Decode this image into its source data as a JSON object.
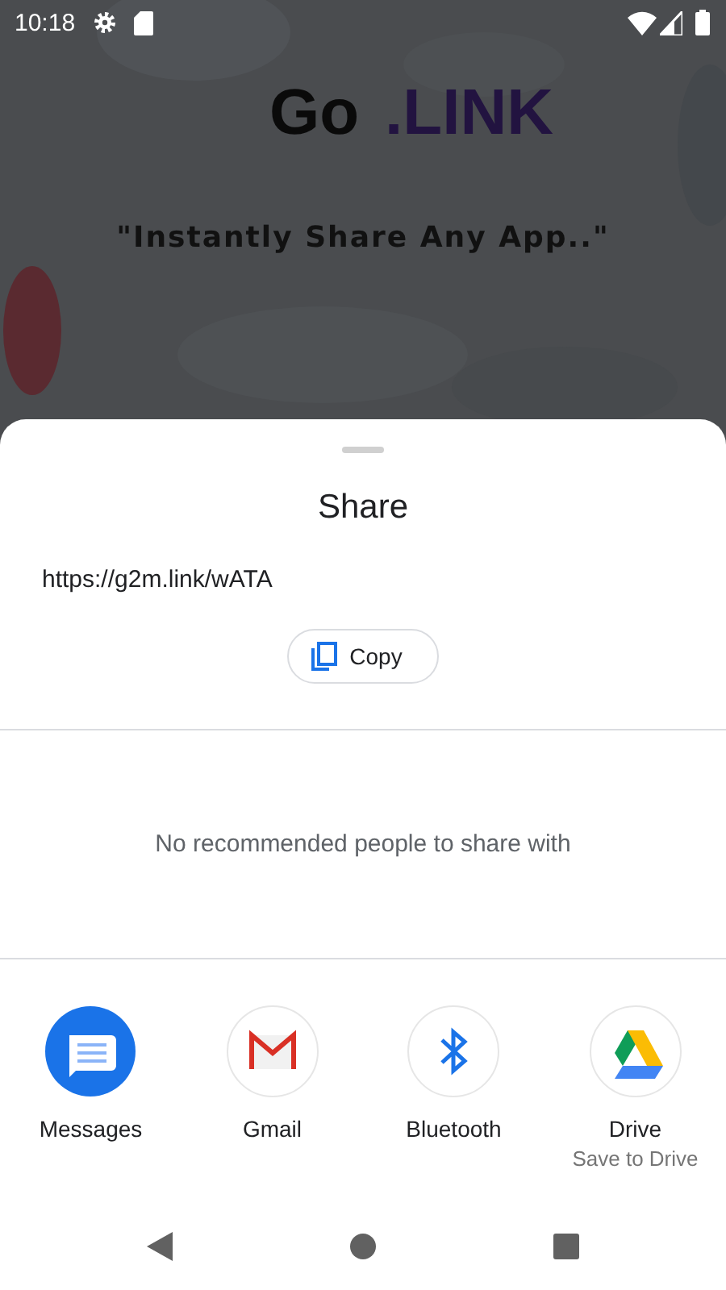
{
  "status_bar": {
    "time": "10:18"
  },
  "app": {
    "logo_left": "Go",
    "logo_right": ".LINK",
    "tagline": "\"Instantly Share Any App..\""
  },
  "share_sheet": {
    "title": "Share",
    "link": "https://g2m.link/wATA",
    "copy_button": "Copy",
    "empty_message": "No recommended people to share with",
    "apps": [
      {
        "kind": "messages",
        "label": "Messages"
      },
      {
        "kind": "gmail",
        "label": "Gmail"
      },
      {
        "kind": "bluetooth",
        "label": "Bluetooth"
      },
      {
        "kind": "drive",
        "label": "Drive",
        "sublabel": "Save to Drive"
      }
    ]
  }
}
